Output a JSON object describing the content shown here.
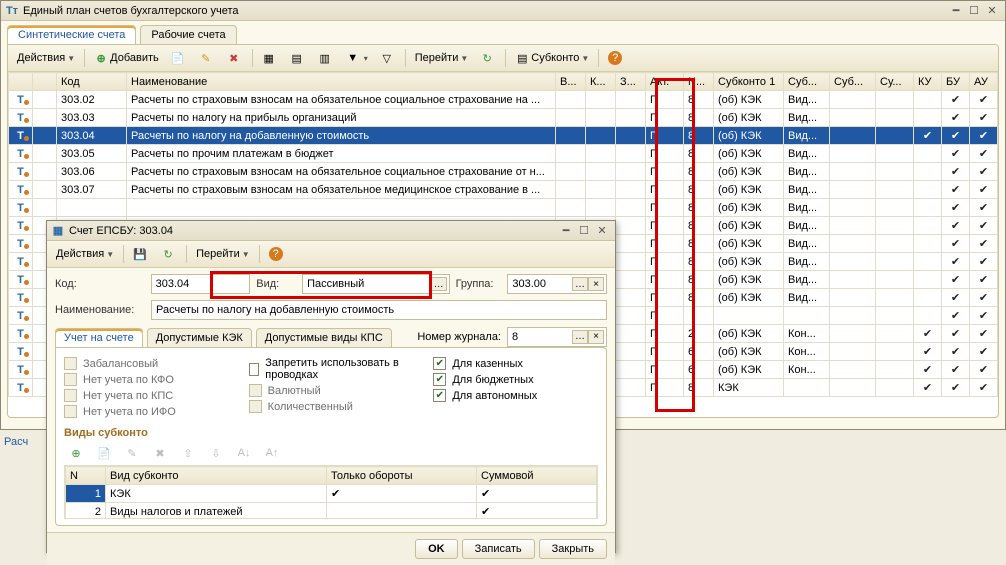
{
  "main": {
    "title": "Единый план счетов бухгалтерского учета",
    "tabs": {
      "t1": "Синтетические счета",
      "t2": "Рабочие счета"
    },
    "toolbar": {
      "actions": "Действия",
      "add": "Добавить",
      "goto": "Перейти",
      "subkonto": "Субконто"
    },
    "columns": {
      "code": "Код",
      "name": "Наименование",
      "v": "В...",
      "k": "К...",
      "z": "З...",
      "act": "Акт.",
      "n": "N...",
      "sub1": "Субконто 1",
      "sub": "Суб...",
      "sub3": "Суб...",
      "sub4": "Су...",
      "ku": "КУ",
      "bu": "БУ",
      "au": "АУ"
    },
    "rows": [
      {
        "code": "303.02",
        "name": "Расчеты по страховым взносам на обязательное социальное страхование на ...",
        "act": "П",
        "n": "8",
        "s1": "(об) КЭК",
        "s2": "Вид...",
        "ku": "",
        "bu": "✔",
        "au": "✔"
      },
      {
        "code": "303.03",
        "name": "Расчеты по налогу на прибыль организаций",
        "act": "П",
        "n": "8",
        "s1": "(об) КЭК",
        "s2": "Вид...",
        "ku": "",
        "bu": "✔",
        "au": "✔"
      },
      {
        "code": "303.04",
        "name": "Расчеты по налогу на добавленную стоимость",
        "act": "П",
        "n": "8",
        "s1": "(об) КЭК",
        "s2": "Вид...",
        "ku": "✔",
        "bu": "✔",
        "au": "✔",
        "selected": true
      },
      {
        "code": "303.05",
        "name": "Расчеты по прочим платежам в бюджет",
        "act": "П",
        "n": "8",
        "s1": "(об) КЭК",
        "s2": "Вид...",
        "ku": "",
        "bu": "✔",
        "au": "✔"
      },
      {
        "code": "303.06",
        "name": "Расчеты по страховым взносам на обязательное социальное страхование от н...",
        "act": "П",
        "n": "8",
        "s1": "(об) КЭК",
        "s2": "Вид...",
        "ku": "",
        "bu": "✔",
        "au": "✔"
      },
      {
        "code": "303.07",
        "name": "Расчеты по страховым взносам на обязательное медицинское страхование в ...",
        "act": "П",
        "n": "8",
        "s1": "(об) КЭК",
        "s2": "Вид...",
        "ku": "",
        "bu": "✔",
        "au": "✔"
      },
      {
        "code": "",
        "name": "",
        "act": "П",
        "n": "8",
        "s1": "(об) КЭК",
        "s2": "Вид...",
        "ku": "",
        "bu": "✔",
        "au": "✔"
      },
      {
        "code": "",
        "name": "",
        "act": "П",
        "n": "8",
        "s1": "(об) КЭК",
        "s2": "Вид...",
        "ku": "",
        "bu": "✔",
        "au": "✔"
      },
      {
        "code": "",
        "name": "",
        "act": "П",
        "n": "8",
        "s1": "(об) КЭК",
        "s2": "Вид...",
        "ku": "",
        "bu": "✔",
        "au": "✔"
      },
      {
        "code": "",
        "name": "",
        "act": "П",
        "n": "8",
        "s1": "(об) КЭК",
        "s2": "Вид...",
        "ku": "",
        "bu": "✔",
        "au": "✔"
      },
      {
        "code": "",
        "name": "",
        "act": "П",
        "n": "8",
        "s1": "(об) КЭК",
        "s2": "Вид...",
        "ku": "",
        "bu": "✔",
        "au": "✔"
      },
      {
        "code": "",
        "name": "",
        "act": "П",
        "n": "8",
        "s1": "(об) КЭК",
        "s2": "Вид...",
        "ku": "",
        "bu": "✔",
        "au": "✔"
      },
      {
        "code": "",
        "name": "",
        "act": "П",
        "n": "",
        "s1": "",
        "s2": "",
        "ku": "",
        "bu": "✔",
        "au": "✔"
      },
      {
        "code": "",
        "name": "",
        "act": "П",
        "n": "2",
        "s1": "(об) КЭК",
        "s2": "Кон...",
        "ku": "✔",
        "bu": "✔",
        "au": "✔"
      },
      {
        "code": "",
        "name": "",
        "act": "П",
        "n": "6",
        "s1": "(об) КЭК",
        "s2": "Кон...",
        "ku": "✔",
        "bu": "✔",
        "au": "✔"
      },
      {
        "code": "",
        "name": "",
        "act": "П",
        "n": "6",
        "s1": "(об) КЭК",
        "s2": "Кон...",
        "ku": "✔",
        "bu": "✔",
        "au": "✔"
      },
      {
        "code": "",
        "name": "",
        "act": "П",
        "n": "8",
        "s1": "КЭК",
        "s2": "",
        "ku": "✔",
        "bu": "✔",
        "au": "✔"
      }
    ],
    "left_label": "Расч"
  },
  "dialog": {
    "title": "Счет ЕПСБУ: 303.04",
    "toolbar": {
      "actions": "Действия",
      "goto": "Перейти"
    },
    "labels": {
      "code": "Код:",
      "kind": "Вид:",
      "group": "Группа:",
      "name": "Наименование:",
      "journal": "Номер журнала:"
    },
    "values": {
      "code": "303.04",
      "kind": "Пассивный",
      "group": "303.00",
      "name": "Расчеты по налогу на добавленную стоимость",
      "journal": "8"
    },
    "tabs": {
      "t1": "Учет на счете",
      "t2": "Допустимые КЭК",
      "t3": "Допустимые виды КПС"
    },
    "checks": {
      "zabal": "Забалансовый",
      "kfo": "Нет учета по КФО",
      "kps": "Нет учета по КПС",
      "ifo": "Нет учета по ИФО",
      "forbid": "Запретить использовать в проводках",
      "val": "Валютный",
      "qty": "Количественный",
      "kaz": "Для казенных",
      "budg": "Для бюджетных",
      "aut": "Для автономных"
    },
    "section": "Виды субконто",
    "subcols": {
      "n": "N",
      "kind": "Вид субконто",
      "onlyturn": "Только обороты",
      "sum": "Суммовой"
    },
    "subrows": [
      {
        "n": "1",
        "kind": "КЭК",
        "turn": "✔",
        "sum": "✔",
        "sel": true
      },
      {
        "n": "2",
        "kind": "Виды налогов и платежей",
        "turn": "",
        "sum": "✔"
      }
    ],
    "buttons": {
      "ok": "OK",
      "save": "Записать",
      "close": "Закрыть"
    }
  }
}
